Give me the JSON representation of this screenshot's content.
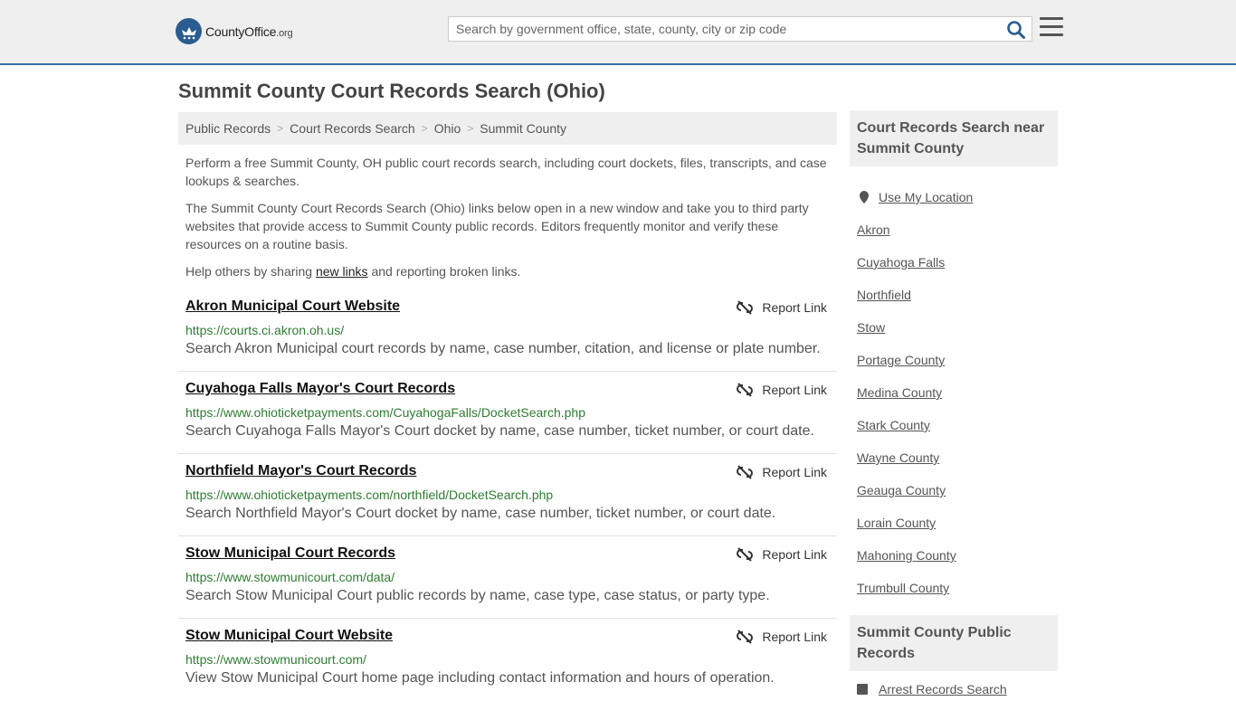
{
  "header": {
    "logo_main": "CountyOffice",
    "logo_suffix": ".org",
    "search_placeholder": "Search by government office, state, county, city or zip code"
  },
  "page_title": "Summit County Court Records Search (Ohio)",
  "breadcrumb": [
    "Public Records",
    "Court Records Search",
    "Ohio",
    "Summit County"
  ],
  "intro": {
    "p1": "Perform a free Summit County, OH public court records search, including court dockets, files, transcripts, and case lookups & searches.",
    "p2": "The Summit County Court Records Search (Ohio) links below open in a new window and take you to third party websites that provide access to Summit County public records. Editors frequently monitor and verify these resources on a routine basis.",
    "p3_before": "Help others by sharing ",
    "p3_link": "new links",
    "p3_after": " and reporting broken links."
  },
  "report_label": "Report Link",
  "listings": [
    {
      "name": "Akron Municipal Court Website",
      "url": "https://courts.ci.akron.oh.us/",
      "desc": "Search Akron Municipal court records by name, case number, citation, and license or plate number."
    },
    {
      "name": "Cuyahoga Falls Mayor's Court Records",
      "url": "https://www.ohioticketpayments.com/CuyahogaFalls/DocketSearch.php",
      "desc": "Search Cuyahoga Falls Mayor's Court docket by name, case number, ticket number, or court date."
    },
    {
      "name": "Northfield Mayor's Court Records",
      "url": "https://www.ohioticketpayments.com/northfield/DocketSearch.php",
      "desc": "Search Northfield Mayor's Court docket by name, case number, ticket number, or court date."
    },
    {
      "name": "Stow Municipal Court Records",
      "url": "https://www.stowmunicourt.com/data/",
      "desc": "Search Stow Municipal Court public records by name, case type, case status, or party type."
    },
    {
      "name": "Stow Municipal Court Website",
      "url": "https://www.stowmunicourt.com/",
      "desc": "View Stow Municipal Court home page including contact information and hours of operation."
    }
  ],
  "sidebar": {
    "near_heading": "Court Records Search near Summit County",
    "use_location": "Use My Location",
    "near_items": [
      "Akron",
      "Cuyahoga Falls",
      "Northfield",
      "Stow",
      "Portage County",
      "Medina County",
      "Stark County",
      "Wayne County",
      "Geauga County",
      "Lorain County",
      "Mahoning County",
      "Trumbull County"
    ],
    "public_heading": "Summit County Public Records",
    "public_items": [
      "Arrest Records Search"
    ]
  },
  "colors": {
    "header_bg": "#efefef",
    "header_border": "#3a6ea5",
    "url_green": "#2e7d32",
    "logo_blue": "#2a5d8f"
  }
}
